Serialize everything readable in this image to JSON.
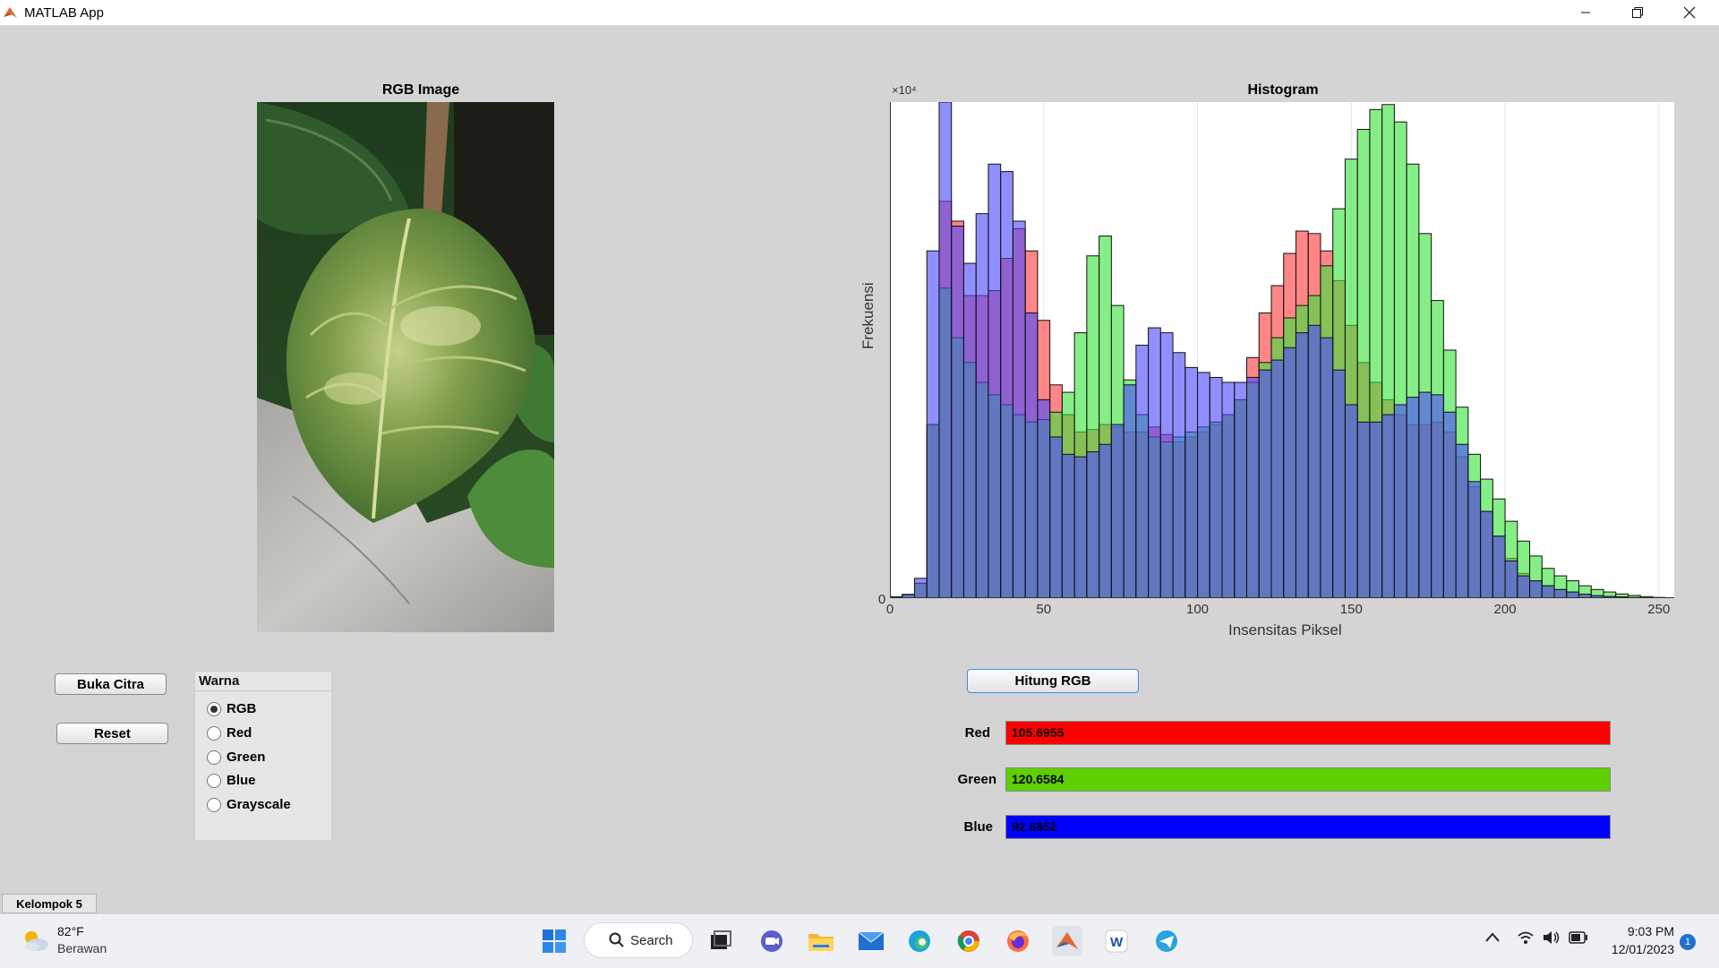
{
  "window": {
    "title": "MATLAB App"
  },
  "rgb_axes": {
    "title": "RGB Image"
  },
  "chart_data": {
    "type": "bar",
    "title": "Histogram",
    "xlabel": "Insensitas Piksel",
    "ylabel": "Frekuensi",
    "y_exponent_label": "×10⁴",
    "xlim": [
      0,
      255
    ],
    "x_ticks": [
      "0",
      "50",
      "100",
      "150",
      "200",
      "250"
    ],
    "y_ticks": [
      "0"
    ],
    "grid": true,
    "bin_width": 4,
    "series": [
      {
        "color": "#ff3b3b",
        "points": [
          [
            0,
            0
          ],
          [
            8,
            0.01
          ],
          [
            12,
            0.05
          ],
          [
            14,
            0.35
          ],
          [
            16,
            0.7
          ],
          [
            20,
            0.9
          ],
          [
            24,
            0.62
          ],
          [
            28,
            0.6
          ],
          [
            32,
            0.62
          ],
          [
            36,
            0.62
          ],
          [
            40,
            0.75
          ],
          [
            44,
            0.74
          ],
          [
            48,
            0.66
          ],
          [
            52,
            0.46
          ],
          [
            56,
            0.4
          ],
          [
            60,
            0.34
          ],
          [
            64,
            0.33
          ],
          [
            68,
            0.35
          ],
          [
            72,
            0.35
          ],
          [
            76,
            0.34
          ],
          [
            80,
            0.33
          ],
          [
            84,
            0.34
          ],
          [
            88,
            0.35
          ],
          [
            92,
            0.31
          ],
          [
            96,
            0.32
          ],
          [
            100,
            0.33
          ],
          [
            104,
            0.34
          ],
          [
            108,
            0.36
          ],
          [
            112,
            0.38
          ],
          [
            116,
            0.42
          ],
          [
            120,
            0.55
          ],
          [
            124,
            0.6
          ],
          [
            128,
            0.66
          ],
          [
            132,
            0.73
          ],
          [
            136,
            0.75
          ],
          [
            140,
            0.72
          ],
          [
            144,
            0.68
          ],
          [
            148,
            0.6
          ],
          [
            152,
            0.5
          ],
          [
            156,
            0.45
          ],
          [
            160,
            0.42
          ],
          [
            164,
            0.38
          ],
          [
            168,
            0.36
          ],
          [
            172,
            0.34
          ],
          [
            176,
            0.36
          ],
          [
            180,
            0.35
          ],
          [
            184,
            0.32
          ],
          [
            188,
            0.25
          ],
          [
            192,
            0.2
          ],
          [
            196,
            0.15
          ],
          [
            200,
            0.1
          ],
          [
            204,
            0.06
          ],
          [
            208,
            0.04
          ],
          [
            212,
            0.03
          ],
          [
            216,
            0.02
          ],
          [
            220,
            0.015
          ],
          [
            224,
            0.01
          ],
          [
            228,
            0.006
          ],
          [
            232,
            0.004
          ],
          [
            236,
            0.003
          ],
          [
            240,
            0.002
          ],
          [
            244,
            0.001
          ],
          [
            248,
            0.0005
          ],
          [
            252,
            0.0002
          ],
          [
            255,
            0
          ]
        ]
      },
      {
        "color": "#3be33b",
        "points": [
          [
            0,
            0
          ],
          [
            8,
            0.01
          ],
          [
            12,
            0.05
          ],
          [
            14,
            0.35
          ],
          [
            16,
            0.7
          ],
          [
            20,
            0.55
          ],
          [
            24,
            0.5
          ],
          [
            28,
            0.45
          ],
          [
            32,
            0.42
          ],
          [
            36,
            0.4
          ],
          [
            40,
            0.38
          ],
          [
            44,
            0.36
          ],
          [
            48,
            0.35
          ],
          [
            52,
            0.37
          ],
          [
            56,
            0.38
          ],
          [
            60,
            0.45
          ],
          [
            64,
            0.62
          ],
          [
            68,
            0.76
          ],
          [
            72,
            0.7
          ],
          [
            76,
            0.48
          ],
          [
            80,
            0.4
          ],
          [
            84,
            0.34
          ],
          [
            88,
            0.31
          ],
          [
            92,
            0.32
          ],
          [
            96,
            0.33
          ],
          [
            100,
            0.34
          ],
          [
            104,
            0.35
          ],
          [
            108,
            0.36
          ],
          [
            112,
            0.38
          ],
          [
            116,
            0.42
          ],
          [
            120,
            0.45
          ],
          [
            124,
            0.5
          ],
          [
            128,
            0.55
          ],
          [
            132,
            0.58
          ],
          [
            136,
            0.6
          ],
          [
            140,
            0.62
          ],
          [
            144,
            0.72
          ],
          [
            148,
            0.85
          ],
          [
            152,
            0.92
          ],
          [
            156,
            0.97
          ],
          [
            160,
            1.0
          ],
          [
            164,
            0.99
          ],
          [
            168,
            0.93
          ],
          [
            172,
            0.82
          ],
          [
            176,
            0.65
          ],
          [
            180,
            0.55
          ],
          [
            184,
            0.45
          ],
          [
            188,
            0.32
          ],
          [
            192,
            0.26
          ],
          [
            196,
            0.22
          ],
          [
            200,
            0.18
          ],
          [
            204,
            0.13
          ],
          [
            208,
            0.1
          ],
          [
            212,
            0.07
          ],
          [
            216,
            0.05
          ],
          [
            220,
            0.04
          ],
          [
            224,
            0.03
          ],
          [
            228,
            0.02
          ],
          [
            232,
            0.015
          ],
          [
            236,
            0.01
          ],
          [
            240,
            0.007
          ],
          [
            244,
            0.004
          ],
          [
            248,
            0.002
          ],
          [
            252,
            0.001
          ],
          [
            255,
            0
          ]
        ]
      },
      {
        "color": "#4b4bff",
        "points": [
          [
            0,
            0
          ],
          [
            8,
            0.01
          ],
          [
            10,
            0.04
          ],
          [
            12,
            0.25
          ],
          [
            14,
            0.7
          ],
          [
            16,
            0.95
          ],
          [
            18,
            1.0
          ],
          [
            20,
            0.85
          ],
          [
            24,
            0.65
          ],
          [
            28,
            0.7
          ],
          [
            32,
            0.85
          ],
          [
            36,
            0.9
          ],
          [
            40,
            0.82
          ],
          [
            44,
            0.7
          ],
          [
            48,
            0.45
          ],
          [
            52,
            0.35
          ],
          [
            56,
            0.3
          ],
          [
            60,
            0.28
          ],
          [
            64,
            0.29
          ],
          [
            68,
            0.3
          ],
          [
            72,
            0.32
          ],
          [
            76,
            0.38
          ],
          [
            80,
            0.48
          ],
          [
            84,
            0.54
          ],
          [
            88,
            0.55
          ],
          [
            92,
            0.52
          ],
          [
            96,
            0.47
          ],
          [
            100,
            0.46
          ],
          [
            104,
            0.45
          ],
          [
            108,
            0.44
          ],
          [
            112,
            0.43
          ],
          [
            116,
            0.44
          ],
          [
            120,
            0.45
          ],
          [
            124,
            0.47
          ],
          [
            128,
            0.49
          ],
          [
            132,
            0.52
          ],
          [
            136,
            0.55
          ],
          [
            140,
            0.55
          ],
          [
            144,
            0.5
          ],
          [
            148,
            0.42
          ],
          [
            152,
            0.36
          ],
          [
            156,
            0.35
          ],
          [
            160,
            0.36
          ],
          [
            164,
            0.38
          ],
          [
            168,
            0.4
          ],
          [
            172,
            0.41
          ],
          [
            176,
            0.42
          ],
          [
            180,
            0.4
          ],
          [
            184,
            0.35
          ],
          [
            188,
            0.27
          ],
          [
            192,
            0.2
          ],
          [
            196,
            0.15
          ],
          [
            200,
            0.1
          ],
          [
            204,
            0.05
          ],
          [
            208,
            0.04
          ],
          [
            212,
            0.03
          ],
          [
            216,
            0.02
          ],
          [
            220,
            0.015
          ],
          [
            224,
            0.01
          ],
          [
            228,
            0.006
          ],
          [
            232,
            0.004
          ],
          [
            236,
            0.003
          ],
          [
            240,
            0.002
          ],
          [
            244,
            0.001
          ],
          [
            248,
            0.0005
          ],
          [
            252,
            0.0002
          ],
          [
            255,
            0
          ]
        ]
      }
    ]
  },
  "buttons": {
    "open_image": "Buka Citra",
    "reset": "Reset",
    "compute_rgb": "Hitung RGB"
  },
  "color_group": {
    "title": "Warna",
    "options": [
      "RGB",
      "Red",
      "Green",
      "Blue",
      "Grayscale"
    ],
    "selected": "RGB"
  },
  "results": [
    {
      "label": "Red",
      "value": "105.6955",
      "color": "#ff0000"
    },
    {
      "label": "Green",
      "value": "120.6584",
      "color": "#5ecf00"
    },
    {
      "label": "Blue",
      "value": "92.6852",
      "color": "#0000ff"
    }
  ],
  "status_tab": "Kelompok 5",
  "taskbar": {
    "weather_temp": "82°F",
    "weather_desc": "Berawan",
    "search_label": "Search",
    "time": "9:03 PM",
    "date": "12/01/2023",
    "notification_count": "1",
    "colors": {
      "start": "#1e6fd9",
      "matlab": "#e16737",
      "telegram": "#2aa3df"
    }
  }
}
